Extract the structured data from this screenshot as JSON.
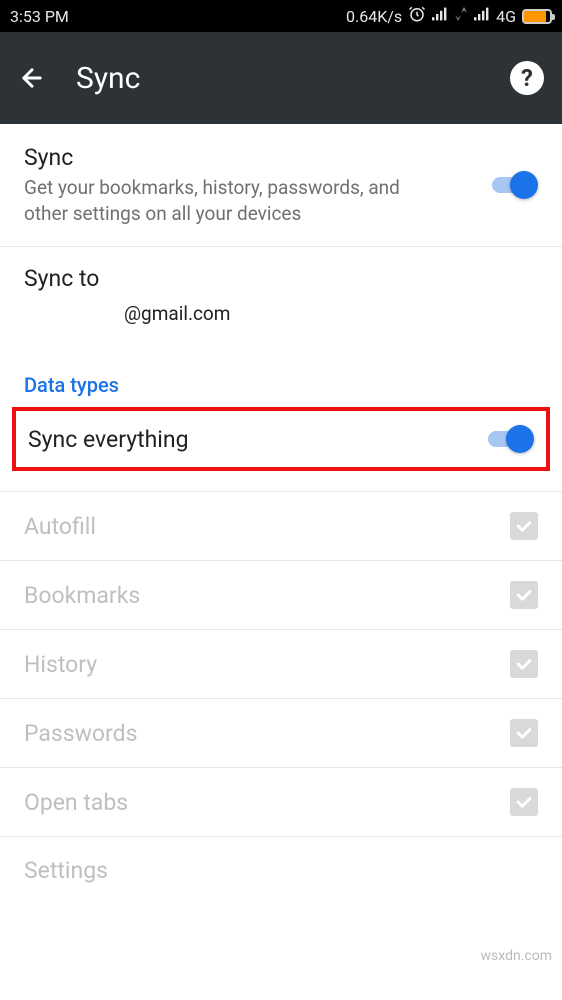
{
  "statusbar": {
    "time": "3:53 PM",
    "speed": "0.64K/s",
    "network": "4G"
  },
  "appbar": {
    "title": "Sync"
  },
  "sync_row": {
    "title": "Sync",
    "desc": "Get your bookmarks, history, passwords, and other settings on all your devices"
  },
  "sync_to": {
    "label": "Sync to",
    "email": "@gmail.com"
  },
  "section": {
    "data_types": "Data types"
  },
  "sync_everything": {
    "label": "Sync everything"
  },
  "items": {
    "autofill": "Autofill",
    "bookmarks": "Bookmarks",
    "history": "History",
    "passwords": "Passwords",
    "open_tabs": "Open tabs",
    "settings": "Settings"
  },
  "watermark": "wsxdn.com"
}
